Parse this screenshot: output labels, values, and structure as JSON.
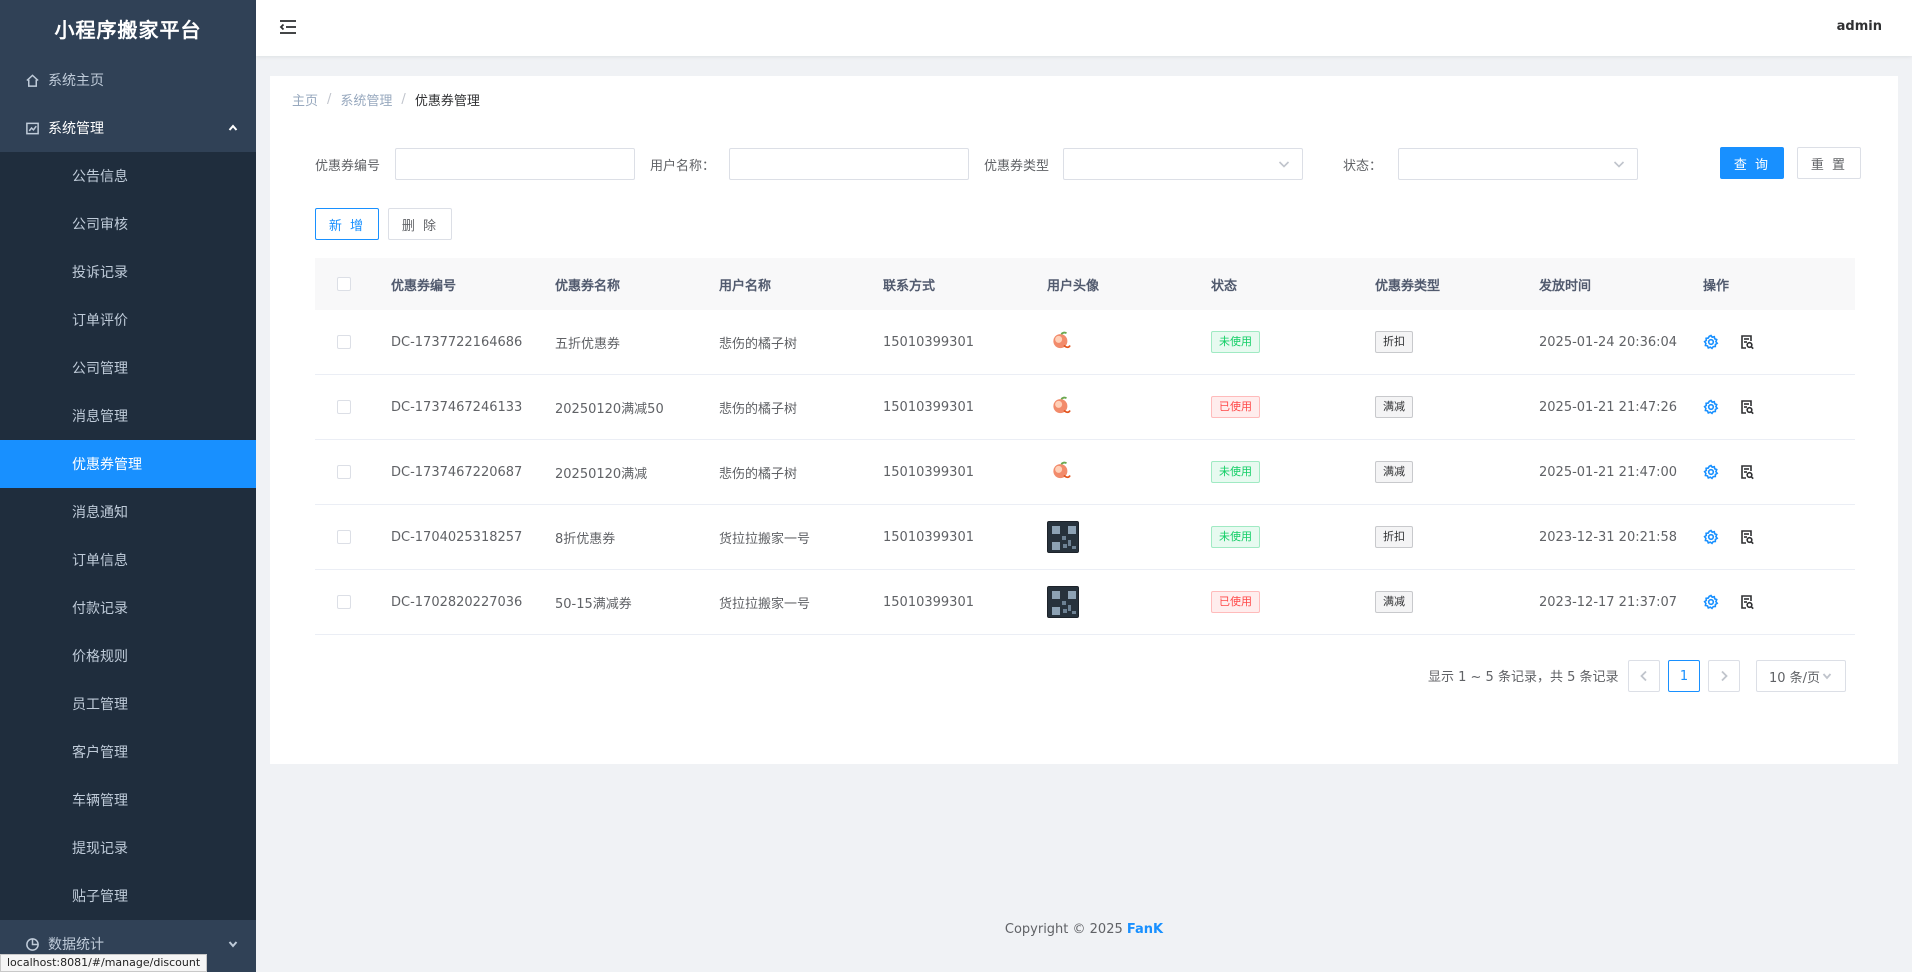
{
  "app": {
    "title": "小程序搬家平台",
    "user": "admin",
    "status_url": "localhost:8081/#/manage/discount"
  },
  "sidebar": {
    "home": "系统主页",
    "system_group": "系统管理",
    "sub_items": [
      "公告信息",
      "公司审核",
      "投诉记录",
      "订单评价",
      "公司管理",
      "消息管理",
      "优惠券管理",
      "消息通知",
      "订单信息",
      "付款记录",
      "价格规则",
      "员工管理",
      "客户管理",
      "车辆管理",
      "提现记录",
      "贴子管理"
    ],
    "active_item": "优惠券管理",
    "stats_group": "数据统计"
  },
  "breadcrumb": {
    "home": "主页",
    "section": "系统管理",
    "current": "优惠券管理"
  },
  "search": {
    "coupon_no_label": "优惠券编号",
    "user_name_label": "用户名称：",
    "coupon_type_label": "优惠券类型",
    "status_label": "状态：",
    "query_button": "查 询",
    "reset_button": "重 置"
  },
  "toolbar": {
    "add_button": "新 增",
    "delete_button": "删 除"
  },
  "table": {
    "headers": [
      "优惠券编号",
      "优惠券名称",
      "用户名称",
      "联系方式",
      "用户头像",
      "状态",
      "优惠券类型",
      "发放时间",
      "操作"
    ],
    "rows": [
      {
        "code": "DC-1737722164686",
        "name": "五折优惠券",
        "user": "悲伤的橘子树",
        "phone": "15010399301",
        "avatar": "peach",
        "status": "未使用",
        "status_kind": "unused",
        "type": "折扣",
        "time": "2025-01-24 20:36:04"
      },
      {
        "code": "DC-1737467246133",
        "name": "20250120满减50",
        "user": "悲伤的橘子树",
        "phone": "15010399301",
        "avatar": "peach",
        "status": "已使用",
        "status_kind": "used",
        "type": "满减",
        "time": "2025-01-21 21:47:26"
      },
      {
        "code": "DC-1737467220687",
        "name": "20250120满减",
        "user": "悲伤的橘子树",
        "phone": "15010399301",
        "avatar": "peach",
        "status": "未使用",
        "status_kind": "unused",
        "type": "满减",
        "time": "2025-01-21 21:47:00"
      },
      {
        "code": "DC-1704025318257",
        "name": "8折优惠券",
        "user": "货拉拉搬家一号",
        "phone": "15010399301",
        "avatar": "qr",
        "status": "未使用",
        "status_kind": "unused",
        "type": "折扣",
        "time": "2023-12-31 20:21:58"
      },
      {
        "code": "DC-1702820227036",
        "name": "50-15满减券",
        "user": "货拉拉搬家一号",
        "phone": "15010399301",
        "avatar": "qr",
        "status": "已使用",
        "status_kind": "used",
        "type": "满减",
        "time": "2023-12-17 21:37:07"
      }
    ]
  },
  "pagination": {
    "summary": "显示 1 ~ 5 条记录，共 5 条记录",
    "current_page": "1",
    "page_size": "10 条/页"
  },
  "footer": {
    "copyright": "Copyright © 2025 ",
    "brand": "FanK"
  },
  "colors": {
    "sidebar_bg": "#304156",
    "submenu_bg": "#1f2d3d",
    "primary": "#1890ff",
    "success": "#13ce66",
    "danger": "#ff4949"
  }
}
